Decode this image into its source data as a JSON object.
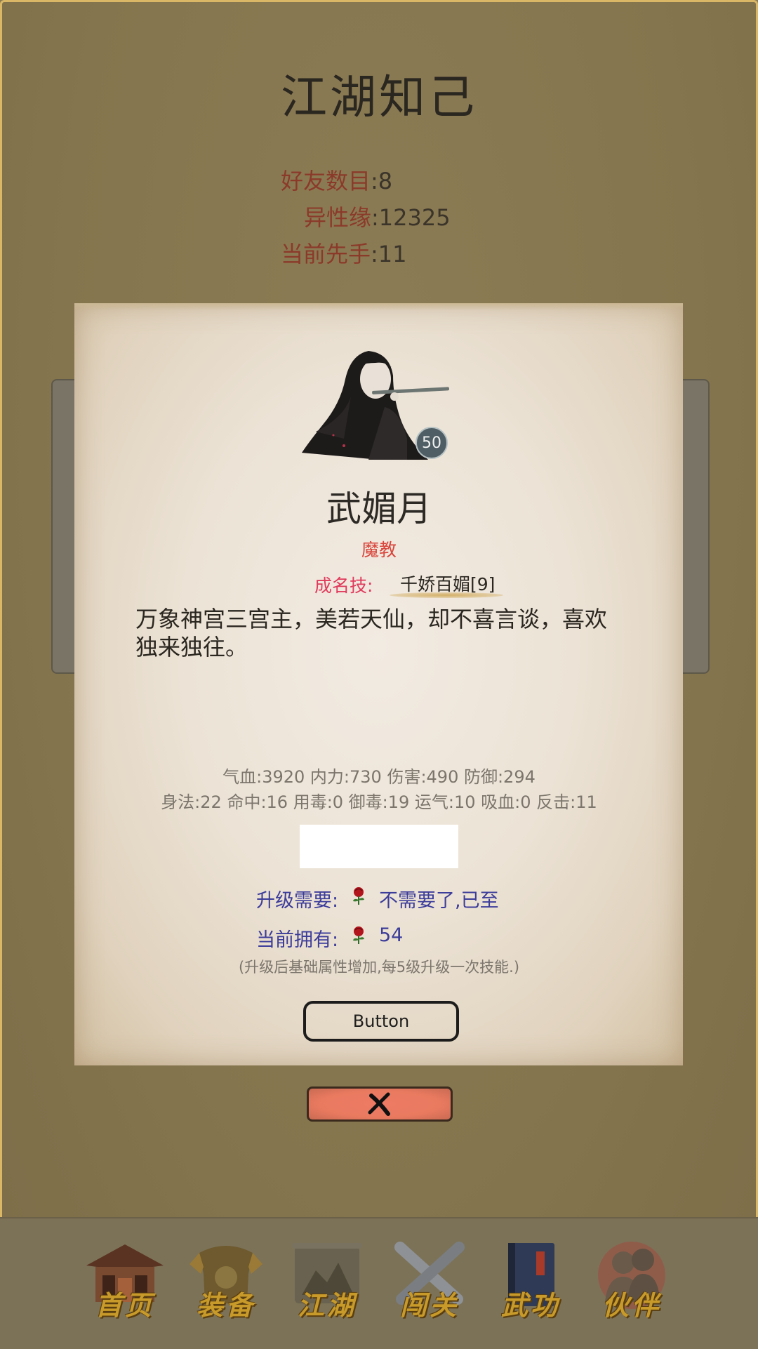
{
  "header": {
    "title": "江湖知己"
  },
  "stats": [
    {
      "label": "好友数目",
      "value": ":8"
    },
    {
      "label": "异性缘",
      "value": ":12325"
    },
    {
      "label": "当前先手",
      "value": ":11"
    }
  ],
  "hero": {
    "level": "50",
    "name": "武媚月",
    "sect": "魔教",
    "skill_label": "成名技:",
    "skill_name": "千娇百媚[9]",
    "description": "万象神宫三宫主，美若天仙，却不喜言谈，喜欢独来独往。",
    "attrs_line1": "气血:3920  内力:730  伤害:490  防御:294",
    "attrs_line2": "身法:22  命中:16  用毒:0  御毒:19  运气:10  吸血:0  反击:11"
  },
  "upgrade": {
    "need_label": "升级需要:",
    "need_value": "不需要了,已至",
    "own_label": "当前拥有:",
    "own_value": "54",
    "hint": "(升级后基础属性增加,每5级升级一次技能.)",
    "item_icon": "rose-icon"
  },
  "actions": {
    "button_label": "Button",
    "close_icon": "close-icon"
  },
  "nav": [
    {
      "label": "首页",
      "icon": "house-icon"
    },
    {
      "label": "装备",
      "icon": "armor-icon"
    },
    {
      "label": "江湖",
      "icon": "scroll-icon"
    },
    {
      "label": "闯关",
      "icon": "crossed-swords-icon"
    },
    {
      "label": "武功",
      "icon": "book-icon"
    },
    {
      "label": "伙伴",
      "icon": "partners-icon"
    }
  ],
  "colors": {
    "background": "#8a7a52",
    "frame_border": "#d9b766",
    "stat_label": "#8b3a2a",
    "sect": "#d9453c",
    "skill_label": "#e03a5c",
    "upgrade_text": "#3c3c9a",
    "close_button": "#ee7a64",
    "nav_label": "#c79a2a"
  }
}
